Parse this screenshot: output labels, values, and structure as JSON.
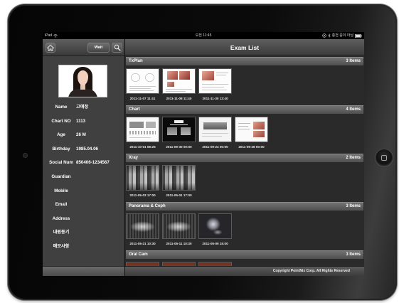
{
  "status_bar": {
    "device": "iPad",
    "time": "오전 11:45",
    "battery_text": "충전 중이 아님"
  },
  "toolbar": {
    "home_icon": "home-icon",
    "wait_label": "Wait",
    "search_icon": "search-icon"
  },
  "header": {
    "title": "Exam List"
  },
  "patient": {
    "fields": [
      {
        "label": "Name",
        "value": "고애정"
      },
      {
        "label": "Chart NO",
        "value": "1113"
      },
      {
        "label": "Age",
        "value": "26 M"
      },
      {
        "label": "Birthday",
        "value": "1985.04.06"
      },
      {
        "label": "Social Num",
        "value": "850406-1234567"
      },
      {
        "label": "Guardian",
        "value": ""
      },
      {
        "label": "Mobile",
        "value": ""
      },
      {
        "label": "Email",
        "value": ""
      },
      {
        "label": "Address",
        "value": ""
      },
      {
        "label": "내원동기",
        "value": ""
      },
      {
        "label": "메모사항",
        "value": ""
      }
    ]
  },
  "exam_list": {
    "sections": [
      {
        "title": "TxPlan",
        "count": "3 Items",
        "items": [
          {
            "image": "treatment-plan-diagram-thumbnail",
            "date": "2011-11-07 11:41"
          },
          {
            "image": "treatment-plan-photos-thumbnail",
            "date": "2011-11-08 11:40"
          },
          {
            "image": "treatment-plan-photo-thumbnail",
            "date": "2011-11-30 13:40"
          }
        ]
      },
      {
        "title": "Chart",
        "count": "4 Items",
        "items": [
          {
            "image": "chart-diagram-thumbnail",
            "date": "2011-10-01 08:25"
          },
          {
            "image": "chart-xray-sheet-thumbnail",
            "date": "2011-09-30 00:00"
          },
          {
            "image": "chart-panorama-sheet-thumbnail",
            "date": "2011-09-24 00:00"
          },
          {
            "image": "chart-photo-sheet-thumbnail",
            "date": "2011-09-28 00:00"
          }
        ]
      },
      {
        "title": "Xray",
        "count": "2 Items",
        "items": [
          {
            "image": "periapical-xray-thumbnail",
            "date": "2011-05-03 17:00"
          },
          {
            "image": "periapical-xray-thumbnail",
            "date": "2011-05-01 17:00"
          }
        ]
      },
      {
        "title": "Panorama & Ceph",
        "count": "3 Items",
        "items": [
          {
            "image": "panoramic-xray-thumbnail",
            "date": "2011-05-21 10:30"
          },
          {
            "image": "panoramic-xray-thumbnail",
            "date": "2011-05-11 10:30"
          },
          {
            "image": "cephalometric-xray-thumbnail",
            "date": "2011-05-09 15:00"
          }
        ]
      },
      {
        "title": "Oral Cam",
        "count": "3 Items",
        "items": [
          {
            "image": "intraoral-photo-thumbnail"
          },
          {
            "image": "intraoral-photo-thumbnail"
          },
          {
            "image": "intraoral-photo-thumbnail"
          }
        ]
      }
    ]
  },
  "footer": {
    "copyright": "Copyright PointNix Corp. All Rights Reserved"
  },
  "colors": {
    "list_background": "#2a2a2a",
    "panel_background": "#404040",
    "header_text": "#ffffff"
  }
}
